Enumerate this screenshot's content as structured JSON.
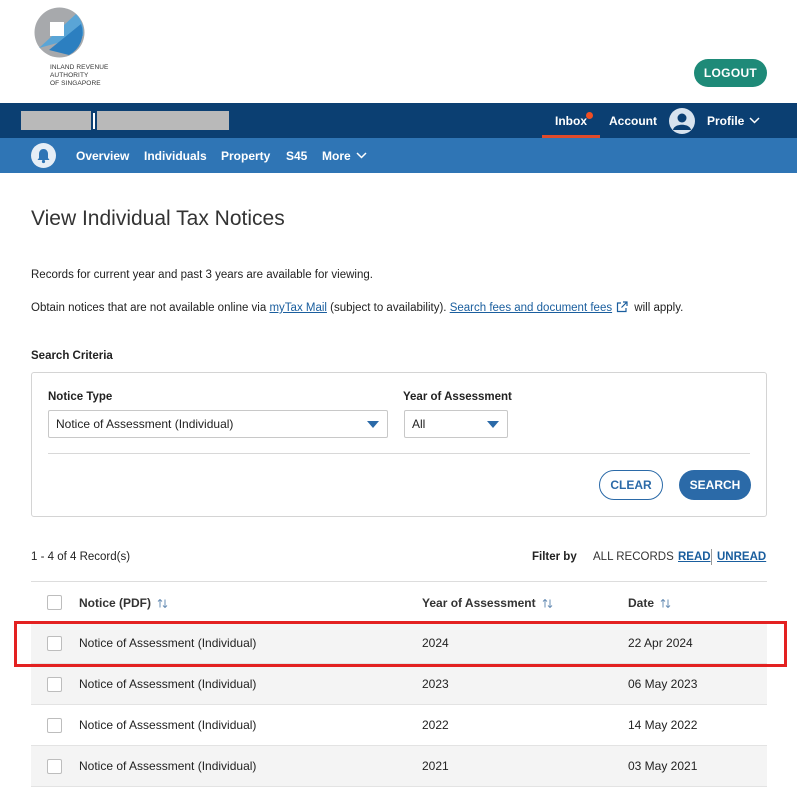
{
  "header": {
    "logo_lines": [
      "INLAND REVENUE",
      "AUTHORITY",
      "OF SINGAPORE"
    ],
    "logout_label": "LOGOUT"
  },
  "topnav": {
    "inbox_label": "Inbox",
    "account_label": "Account",
    "profile_label": "Profile",
    "accent_color": "#e04a2a"
  },
  "subnav": {
    "items": [
      "Overview",
      "Individuals",
      "Property",
      "S45",
      "More"
    ]
  },
  "main": {
    "title": "View Individual Tax Notices",
    "info_line1": "Records for current year and past 3 years are available for viewing.",
    "info_line2_pre": "Obtain notices that are not available online via ",
    "info_link1": "myTax Mail",
    "info_line2_mid": " (subject to availability). ",
    "info_link2": "Search fees and document fees",
    "info_line2_post": " will apply."
  },
  "search": {
    "section_label": "Search Criteria",
    "notice_type_label": "Notice Type",
    "notice_type_value": "Notice of Assessment (Individual)",
    "year_label": "Year of Assessment",
    "year_value": "All",
    "clear_label": "CLEAR",
    "search_label": "SEARCH"
  },
  "results": {
    "count_text": "1 - 4 of 4 Record(s)",
    "filter_label": "Filter by",
    "filter_all": "ALL RECORDS",
    "filter_read": "READ",
    "filter_unread": "UNREAD",
    "columns": [
      "Notice (PDF)",
      "Year of Assessment",
      "Date"
    ],
    "rows": [
      {
        "notice": "Notice of Assessment (Individual)",
        "year": "2024",
        "date": "22 Apr 2024"
      },
      {
        "notice": "Notice of Assessment (Individual)",
        "year": "2023",
        "date": "06 May 2023"
      },
      {
        "notice": "Notice of Assessment (Individual)",
        "year": "2022",
        "date": "14 May 2022"
      },
      {
        "notice": "Notice of Assessment (Individual)",
        "year": "2021",
        "date": "03 May 2021"
      }
    ]
  },
  "colors": {
    "primary_dark": "#0b3f72",
    "primary": "#2f75b5",
    "button_blue": "#2b6aa8",
    "logout_green": "#1e8a78",
    "highlight_red": "#e32121"
  },
  "icons": [
    "iras-logo-icon",
    "notification-dot-icon",
    "user-avatar-icon",
    "chevron-down-icon",
    "bell-icon",
    "external-link-icon",
    "dropdown-caret-icon",
    "sort-icon",
    "checkbox-icon"
  ]
}
